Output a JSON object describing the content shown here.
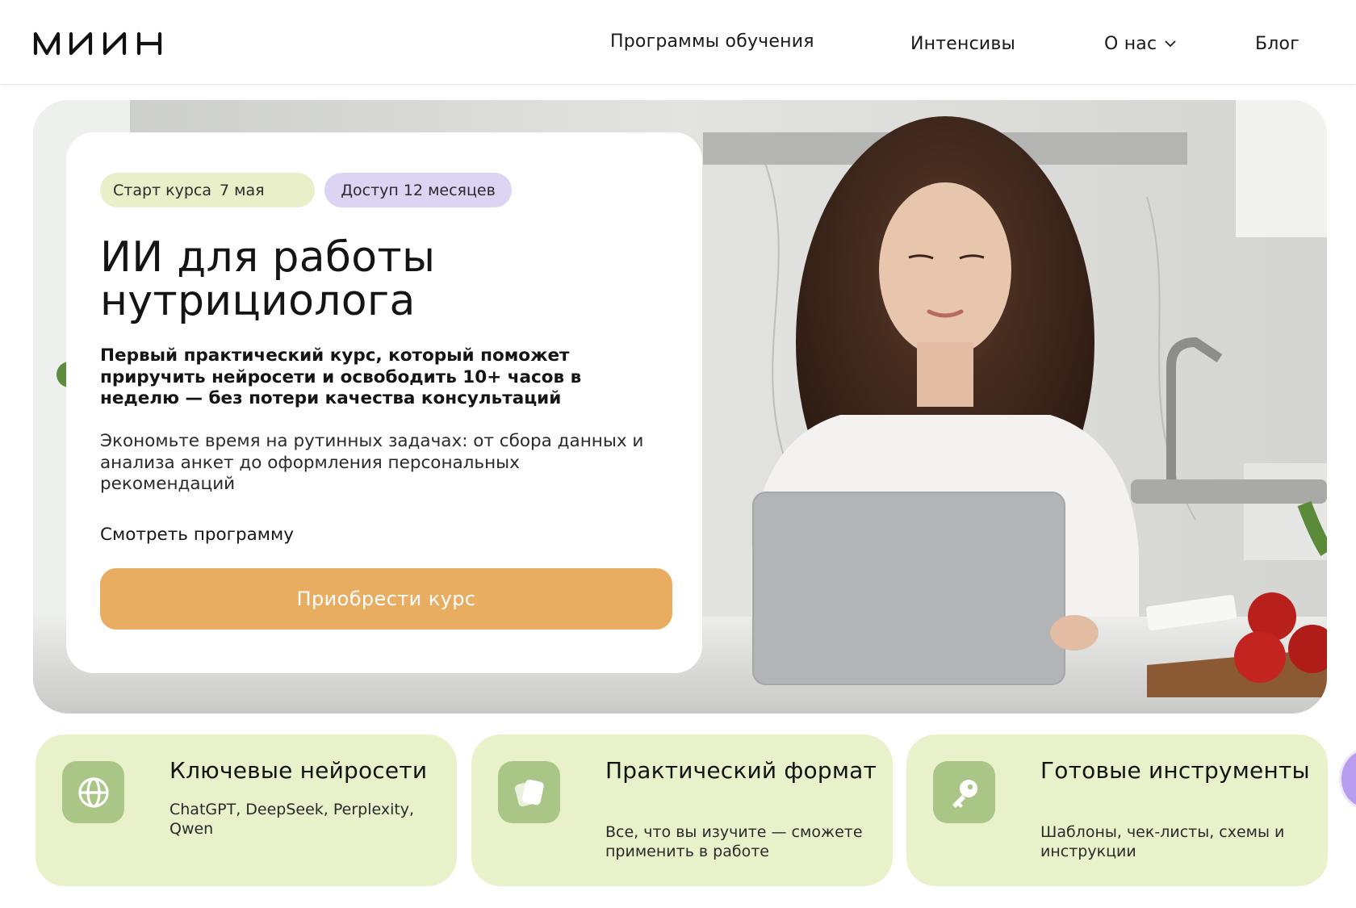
{
  "header": {
    "logo_text": "МИИН",
    "nav": {
      "programs": "Программы обучения",
      "intensives": "Интенсивы",
      "about": "О нас",
      "blog": "Блог"
    }
  },
  "hero": {
    "badge_start_label": "Старт курса",
    "badge_start_date": "7 мая",
    "badge_access": "Доступ 12 месяцев",
    "title": "ИИ для работы нутрициолога",
    "subtitle": "Первый практический курс, который поможет приручить нейросети и освободить 10+ часов в неделю — без потери качества консультаций",
    "description": "Экономьте время на рутинных задачах: от сбора данных и анализа анкет до оформления персональных рекомендаций",
    "program_link": "Смотреть программу",
    "buy_button": "Приобрести курс"
  },
  "features": [
    {
      "icon": "globe-icon",
      "title": "Ключевые нейросети",
      "description": "ChatGPT, DeepSeek, Perplexity, Qwen"
    },
    {
      "icon": "cards-icon",
      "title": "Практический формат",
      "description": "Все, что вы изучите — сможете применить в работе"
    },
    {
      "icon": "key-icon",
      "title": "Готовые инструменты",
      "description": "Шаблоны, чек-листы, схемы и инструкции"
    }
  ],
  "colors": {
    "accent_button": "#e9ad62",
    "badge_start": "#e8efc9",
    "badge_access": "#ddd3f3",
    "feature_bg": "#e9f1cb",
    "feature_icon_bg": "#aac686",
    "chat_bubble": "#b89cf0"
  }
}
